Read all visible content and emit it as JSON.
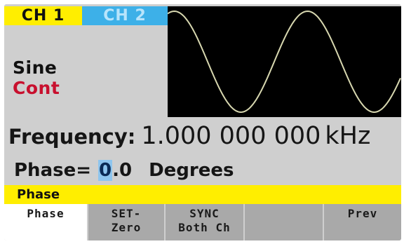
{
  "tabs": [
    {
      "label": "CH 1",
      "active": true
    },
    {
      "label": "CH 2",
      "active": false
    }
  ],
  "waveform": {
    "function": "Sine",
    "mode": "Cont",
    "trace_color": "#d8d8b0"
  },
  "frequency": {
    "label": "Frequency:",
    "value": "1.000 000 000",
    "unit": "kHz"
  },
  "phase": {
    "label": "Phase=",
    "cursor_digit": "0",
    "rest": ".0",
    "unit": "Degrees"
  },
  "softkey_title": "Phase",
  "softkeys": [
    {
      "line1": "Phase",
      "line2": ""
    },
    {
      "line1": "SET-",
      "line2": "Zero"
    },
    {
      "line1": "SYNC",
      "line2": "Both Ch"
    },
    {
      "line1": "",
      "line2": ""
    },
    {
      "line1": "Prev",
      "line2": ""
    }
  ],
  "colors": {
    "ch1_tab": "#ffee00",
    "ch2_tab": "#3db0e8",
    "mode_text": "#c8102e",
    "title_bar": "#ffee00"
  }
}
